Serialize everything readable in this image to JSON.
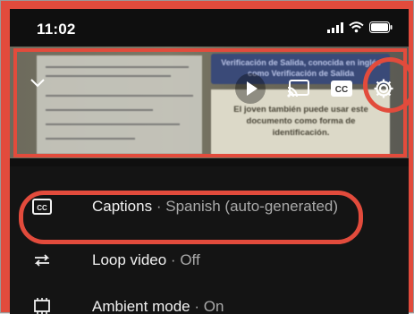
{
  "status": {
    "time": "11:02",
    "icons": [
      "signal-icon",
      "wifi-icon",
      "battery-icon"
    ]
  },
  "video": {
    "banner_text": "Verificación de Salida, conocida en inglés como Verificación de Salida",
    "panel_text": "El joven también puede usar este documento como forma de identificación.",
    "controls": [
      "play-icon",
      "cast-icon",
      "cc-icon",
      "gear-icon"
    ]
  },
  "menu": {
    "items": [
      {
        "label": "Captions",
        "separator": "·",
        "value": "Spanish (auto-generated)",
        "icon": "captions-icon"
      },
      {
        "label": "Loop video",
        "separator": "·",
        "value": "Off",
        "icon": "loop-icon"
      },
      {
        "label": "Ambient mode",
        "separator": "·",
        "value": "On",
        "icon": "ambient-mode-icon"
      }
    ]
  },
  "colors": {
    "highlight": "#e24b3c",
    "background": "#0f0f0f",
    "text": "#f1f1f1",
    "subtext": "#a9a9a9"
  }
}
